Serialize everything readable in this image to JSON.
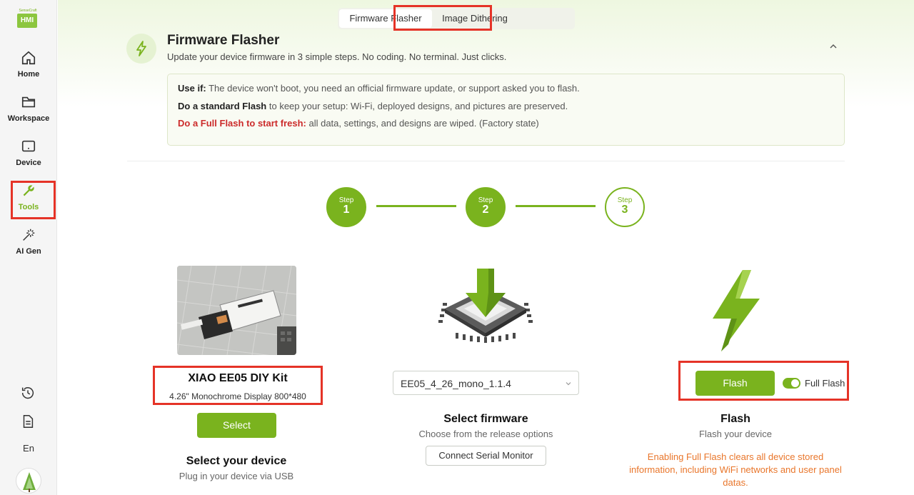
{
  "sidebar": {
    "logo": {
      "top": "SenseCraft",
      "box": "HMI"
    },
    "items": [
      {
        "label": "Home",
        "icon": "home-icon"
      },
      {
        "label": "Workspace",
        "icon": "folder-icon"
      },
      {
        "label": "Device",
        "icon": "device-icon"
      },
      {
        "label": "Tools",
        "icon": "wrench-icon"
      },
      {
        "label": "AI Gen",
        "icon": "magic-wand-icon"
      }
    ],
    "language": "En"
  },
  "tabs": [
    "Firmware Flasher",
    "Image Dithering"
  ],
  "header": {
    "title": "Firmware Flasher",
    "subtitle": "Update your device firmware in 3 simple steps. No coding. No terminal. Just clicks."
  },
  "info": {
    "use_if_label": "Use if:",
    "use_if_text": " The device won't boot, you need an official firmware update, or support asked you to flash.",
    "standard_label": "Do a standard Flash",
    "standard_text": " to keep your setup: Wi-Fi, deployed designs, and pictures are preserved.",
    "full_label": "Do a Full Flash to start fresh:",
    "full_text": " all data, settings, and designs are wiped. (Factory state)"
  },
  "steps": [
    {
      "label": "Step",
      "num": "1"
    },
    {
      "label": "Step",
      "num": "2"
    },
    {
      "label": "Step",
      "num": "3"
    }
  ],
  "device": {
    "name": "XIAO EE05 DIY Kit",
    "desc": "4.26\" Monochrome Display 800*480",
    "select_label": "Select",
    "title": "Select your device",
    "subtitle": "Plug in your device via USB"
  },
  "firmware": {
    "selected": "EE05_4_26_mono_1.1.4",
    "title": "Select firmware",
    "subtitle": "Choose from the release options",
    "serial_label": "Connect Serial Monitor"
  },
  "flash": {
    "button_label": "Flash",
    "toggle_label": "Full Flash",
    "toggle_on": true,
    "title": "Flash",
    "subtitle": "Flash your device",
    "warning": "Enabling Full Flash clears all device stored information, including WiFi networks and user panel datas."
  },
  "colors": {
    "accent": "#7ab31e",
    "highlight": "#e53327",
    "warning": "#e9762b",
    "danger": "#cc2b2b"
  }
}
